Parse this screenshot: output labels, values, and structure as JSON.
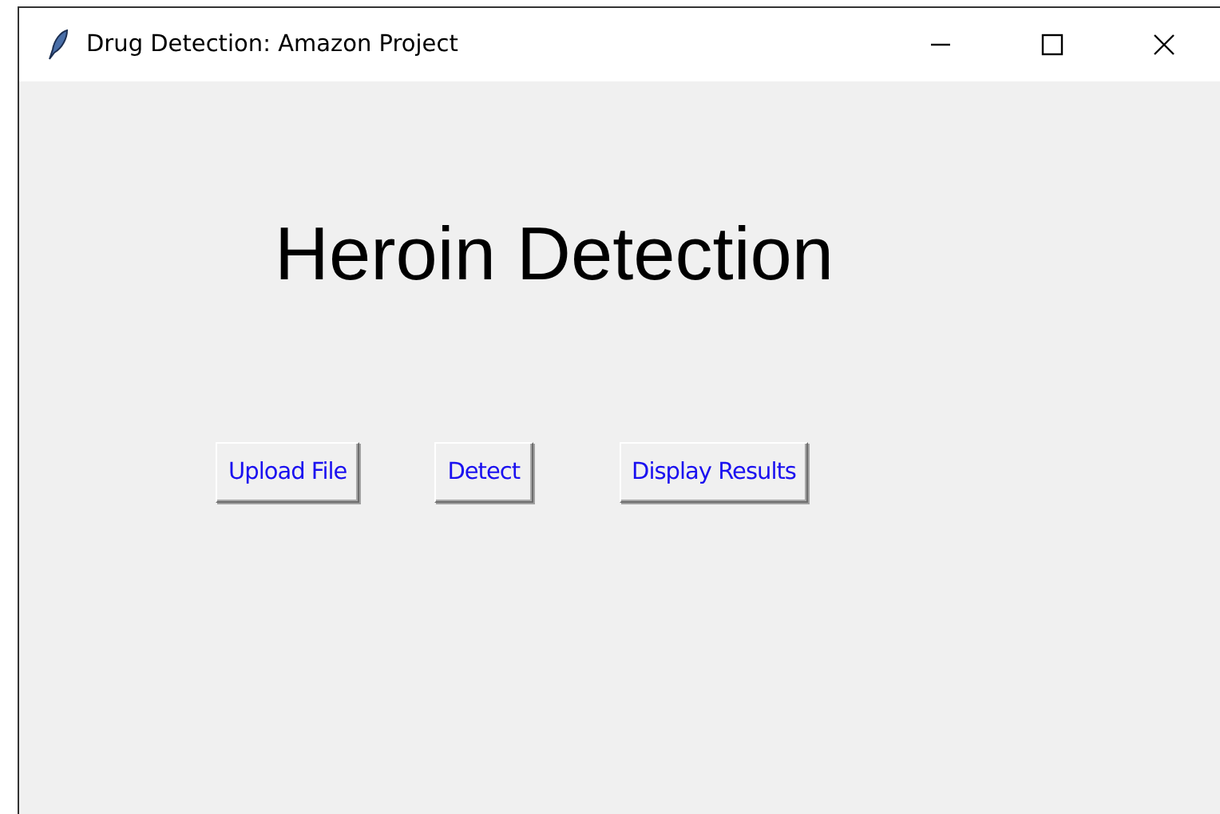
{
  "window": {
    "title": "Drug Detection: Amazon Project"
  },
  "heading": "Heroin Detection",
  "buttons": [
    {
      "label": "Upload File"
    },
    {
      "label": "Detect"
    },
    {
      "label": "Display Results"
    }
  ]
}
